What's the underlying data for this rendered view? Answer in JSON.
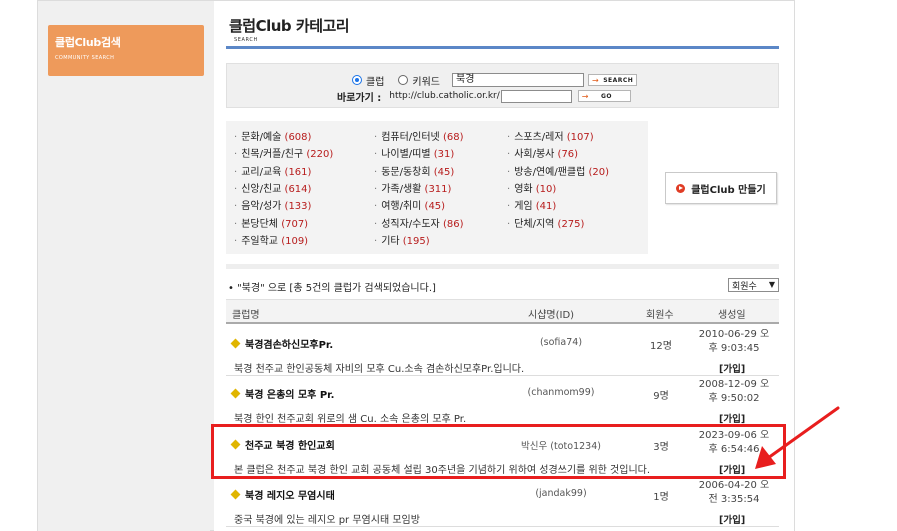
{
  "sidebar": {
    "badge_title": "클럽Club검색",
    "badge_sub": "COMMUNITY SEARCH"
  },
  "header": {
    "title": "클럽Club  카테고리",
    "sub": "SEARCH"
  },
  "search": {
    "radio_club": "클럽",
    "radio_keyword": "키워드",
    "keyword_value": "북경",
    "search_button": "SEARCH",
    "shortcut_label": "바로가기 :",
    "shortcut_url": "http://club.catholic.or.kr/",
    "go_button": "GO"
  },
  "categories": [
    {
      "name": "문화/예술",
      "count": "(608)"
    },
    {
      "name": "컴퓨터/인터넷",
      "count": "(68)"
    },
    {
      "name": "스포츠/레저",
      "count": "(107)"
    },
    {
      "name": "친목/커플/친구",
      "count": "(220)"
    },
    {
      "name": "나이별/띠별",
      "count": "(31)"
    },
    {
      "name": "사회/봉사",
      "count": "(76)"
    },
    {
      "name": "교리/교육",
      "count": "(161)"
    },
    {
      "name": "동문/동창회",
      "count": "(45)"
    },
    {
      "name": "방송/연예/팬클럽",
      "count": "(20)"
    },
    {
      "name": "신앙/친교",
      "count": "(614)"
    },
    {
      "name": "가족/생활",
      "count": "(311)"
    },
    {
      "name": "영화",
      "count": "(10)"
    },
    {
      "name": "음악/성가",
      "count": "(133)"
    },
    {
      "name": "여행/취미",
      "count": "(45)"
    },
    {
      "name": "게임",
      "count": "(41)"
    },
    {
      "name": "본당단체",
      "count": "(707)"
    },
    {
      "name": "성직자/수도자",
      "count": "(86)"
    },
    {
      "name": "단체/지역",
      "count": "(275)"
    },
    {
      "name": "주일학교",
      "count": "(109)"
    },
    {
      "name": "기타",
      "count": "(195)"
    }
  ],
  "make_button": "클럽Club 만들기",
  "result_text": "\"북경\" 으로 [총 5건의 클럽가 검색되었습니다.]",
  "sort_select": "회원수",
  "table": {
    "headers": [
      "클럽명",
      "시샵명(ID)",
      "회원수",
      "생성일"
    ],
    "rows": [
      {
        "name": "북경겸손하신모후Pr.",
        "sysop": "(sofia74)",
        "members": "12명",
        "date1": "2010-06-29 오",
        "date2": "후 9:03:45",
        "desc": "북경 천주교 한인공동체 자비의 모후 Cu.소속 겸손하신모후Pr.입니다.",
        "join": "[가입]"
      },
      {
        "name": "북경 은총의 모후 Pr.",
        "sysop": "(chanmom99)",
        "members": "9명",
        "date1": "2008-12-09 오",
        "date2": "후 9:50:02",
        "desc": "북경 한인 천주교회 위로의 샘 Cu. 소속 은총의 모후 Pr.",
        "join": "[가입]"
      },
      {
        "name": "천주교 북경 한인교회",
        "sysop": "박신우 (toto1234)",
        "members": "3명",
        "date1": "2023-09-06 오",
        "date2": "후 6:54:46",
        "desc": "본 클럽은 천주교 북경 한인 교회 공동체 설립 30주년을 기념하기 위하여 성경쓰기를 위한 것입니다.",
        "join": "[가입]"
      },
      {
        "name": "북경 레지오 무염시태",
        "sysop": "(jandak99)",
        "members": "1명",
        "date1": "2006-04-20 오",
        "date2": "전 3:35:54",
        "desc": "중국 북경에 있는 레지오 pr 무염시태 모임방",
        "join": "[가입]"
      }
    ]
  },
  "colors": {
    "badge": "#ee9a5b",
    "accent_line": "#5b87c7",
    "count_red": "#b71c1c",
    "highlight": "#e81e1e"
  }
}
